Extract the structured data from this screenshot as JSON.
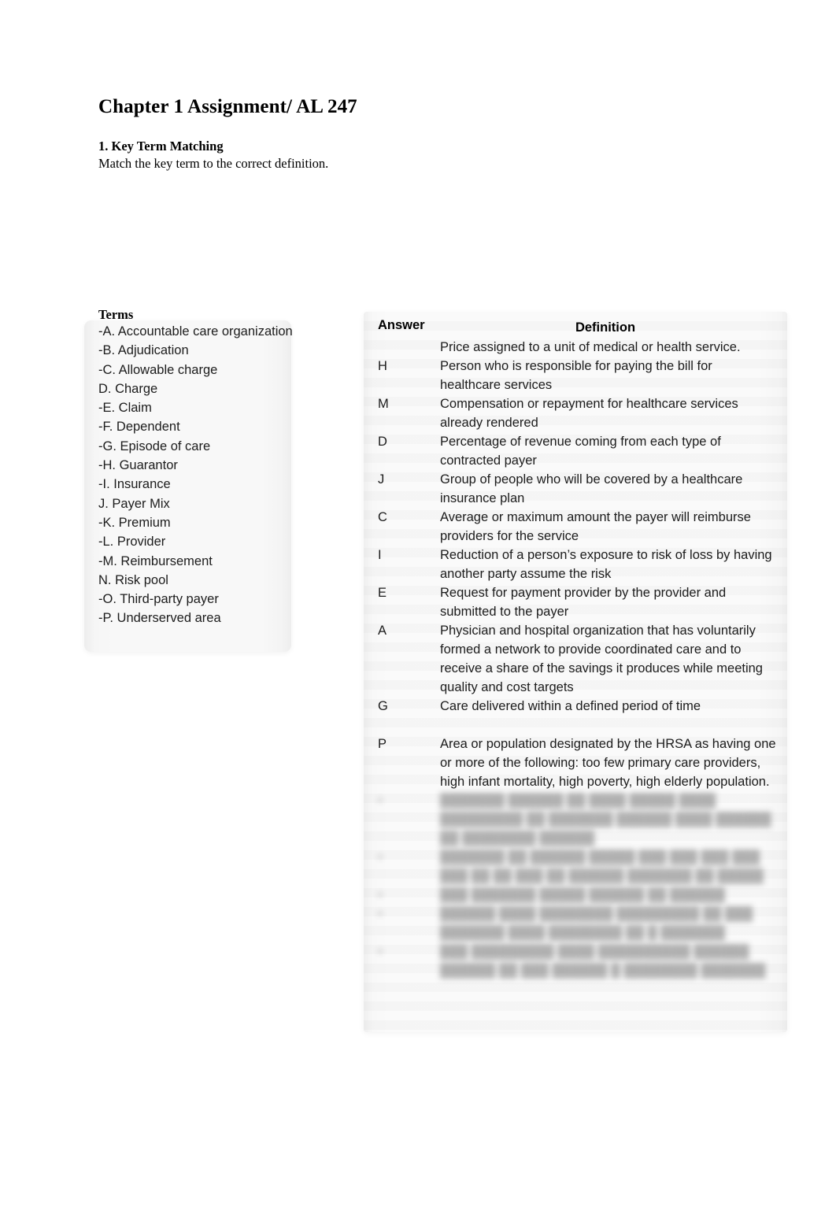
{
  "document": {
    "title": "Chapter 1 Assignment/ AL 247",
    "section_number_and_title": "1.  Key Term Matching",
    "instruction": "Match the key term to the correct definition."
  },
  "terms_panel": {
    "heading": "Terms",
    "items": [
      "-A. Accountable care organization",
      "-B. Adjudication",
      "-C. Allowable charge",
      "D. Charge",
      "-E. Claim",
      "-F. Dependent",
      "-G. Episode of care",
      "-H. Guarantor",
      "-I. Insurance",
      "J. Payer Mix",
      "-K. Premium",
      "-L. Provider",
      "-M. Reimbursement",
      "N. Risk pool",
      "-O. Third-party payer",
      "-P. Underserved area"
    ]
  },
  "matching_table": {
    "headers": {
      "answer": "Answer",
      "definition": "Definition"
    },
    "rows": [
      {
        "answer": "",
        "definition": "Price assigned to a unit of medical or health service.",
        "blurred": false
      },
      {
        "answer": "H",
        "definition": "Person who is responsible for paying the bill for healthcare services",
        "blurred": false
      },
      {
        "answer": "M",
        "definition": "Compensation or repayment for healthcare services already rendered",
        "blurred": false
      },
      {
        "answer": "D",
        "definition": "Percentage of revenue coming from each type of contracted payer",
        "blurred": false
      },
      {
        "answer": "J",
        "definition": "Group of people who will be covered by a healthcare insurance plan",
        "blurred": false
      },
      {
        "answer": "C",
        "definition": "Average or maximum amount the payer will reimburse providers for the service",
        "blurred": false
      },
      {
        "answer": "I",
        "definition": "Reduction of a person’s exposure to risk of loss by having another party assume the risk",
        "blurred": false
      },
      {
        "answer": "E",
        "definition": "Request for payment provider by the provider and submitted to the payer",
        "blurred": false
      },
      {
        "answer": "A",
        "definition": "Physician and hospital organization that has voluntarily formed a network to provide coordinated care and to receive a share of the savings it produces while meeting quality and cost targets",
        "blurred": false
      },
      {
        "answer": "G",
        "definition": "Care delivered within a defined period of time",
        "blurred": false
      },
      {
        "answer": "",
        "definition": "",
        "blurred": false
      },
      {
        "answer": "P",
        "definition": "Area or population designated by the HRSA as having one or more of the following: too few primary care providers, high infant mortality, high poverty, high elderly population.",
        "blurred": false
      },
      {
        "answer": "•",
        "definition": "███████ ██████ ██ ████ █████ ████ █████████ ██ ███████ ██████ ████ ██████ ██ ████████ ██████",
        "blurred": true
      },
      {
        "answer": "•",
        "definition": "███████ ██ ██████ █████ ███ ███ ███ ███ ███ ██ ██ ███ ██ ██████ ███████ ██ █████",
        "blurred": true
      },
      {
        "answer": "•",
        "definition": "███ ███████ █████ ██████ ██ ██████",
        "blurred": true
      },
      {
        "answer": "•",
        "definition": "██████ ████ ████████ █████████ ██ ███ ███████ ████ ████████ ██ █ ███████",
        "blurred": true
      },
      {
        "answer": "•",
        "definition": "███ █████████ ████ ██████████ ██████ ██████ ██ ███ ██████ █ ████████ ███████",
        "blurred": true
      }
    ]
  }
}
